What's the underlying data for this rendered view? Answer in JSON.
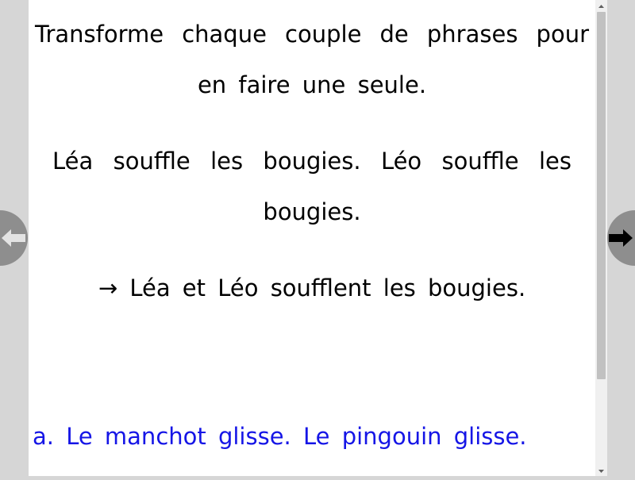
{
  "lesson": {
    "instruction": "Transforme chaque couple de phrases pour en faire une seule.",
    "example_sentence": "Léa souffle les bougies. Léo souffle les bougies.",
    "example_answer": "→ Léa et Léo soufflent les bougies."
  },
  "exercises": [
    {
      "label": "a. Le manchot glisse. Le pingouin glisse."
    }
  ],
  "navigation": {
    "prev_icon": "arrow-left-icon",
    "next_icon": "arrow-right-icon"
  },
  "scrollbar": {
    "position_fraction": 0.0
  },
  "colors": {
    "text": "#000000",
    "exercise_text": "#1515e6",
    "nav_button": "#8e8e8e",
    "background": "#d6d6d6"
  }
}
